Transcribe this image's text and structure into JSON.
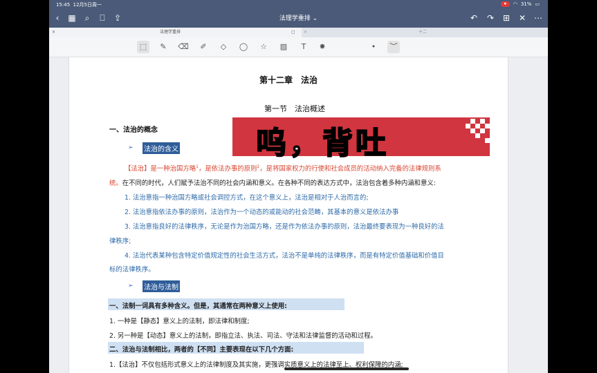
{
  "status": {
    "time": "15:45",
    "date": "12月5日周一",
    "battery": "31%"
  },
  "nav": {
    "title": "法理学重排 ⌄"
  },
  "tabs": [
    {
      "label": "法理学重排"
    },
    {
      "label": "十二"
    }
  ],
  "toolbar": {
    "tools": [
      "image-select",
      "pen",
      "eraser",
      "highlighter",
      "shapes",
      "lasso",
      "sticker",
      "image",
      "text",
      "laser"
    ]
  },
  "sticker": {
    "text": "呜，背吐"
  },
  "doc": {
    "chapter": "第十二章　法治",
    "section": "第一节　法治概述",
    "h1": "一、法治的概念",
    "sub1": "法治的含义",
    "p1_red1": "【法治】是一种治国方略",
    "p1_sup1": "1",
    "p1_red2": "，是依法办事的原则",
    "p1_sup2": "2",
    "p1_red3": "，是将国家权力的行使和社会成员的活动纳入完备的法律规则系",
    "p1_red4": "统。",
    "p1_black": "在不同的时代，人们赋予法治不同的社会内涵和意义。在各种不同的表达方式中，法治包含着多种内涵和意义:",
    "l1": "1. 法治意指一种治国方略或社会调控方式，在这个意义上，法治是相对于人治而言的;",
    "l2": "2. 法治意指依法办事的原则，法治作为一个动态的或能动的社会范畴，其基本的意义是依法办事",
    "l3a": "3. 法治意指良好的法律秩序，无论是作为治国方略，还是作为依法办事的原则，法治最终要表现为一种良好的法",
    "l3b": "律秩序;",
    "l4a": "4. 法治代表某种包含特定价值规定性的社会生活方式，法治不是单纯的法律秩序，而是有特定价值基础和价值目",
    "l4b": "标的法律秩序。",
    "sub2": "法治与法制",
    "h2": "一、法制一词具有多种含义。但是，其通常在两种意义上使用:",
    "m1": "1. 一种是【静态】意义上的法制，即法律和制度;",
    "m2": "2. 另一种是【动态】意义上的法制，即指立法、执法、司法、守法和法律监督的活动和过程。",
    "h3": "二、法治与法制相比，两者的【不同】主要表现在以下几个方面:",
    "n1": "1.【法治】不仅包括形式意义上的法律制度及其实施，更强调实质意义上的法律至上、权利保障的内涵;",
    "bullet": "➢"
  },
  "colors": {
    "accent": "#2f5d9a",
    "red": "#d9452f",
    "band": "#cfe0f2",
    "sticker": "#d1353f"
  }
}
